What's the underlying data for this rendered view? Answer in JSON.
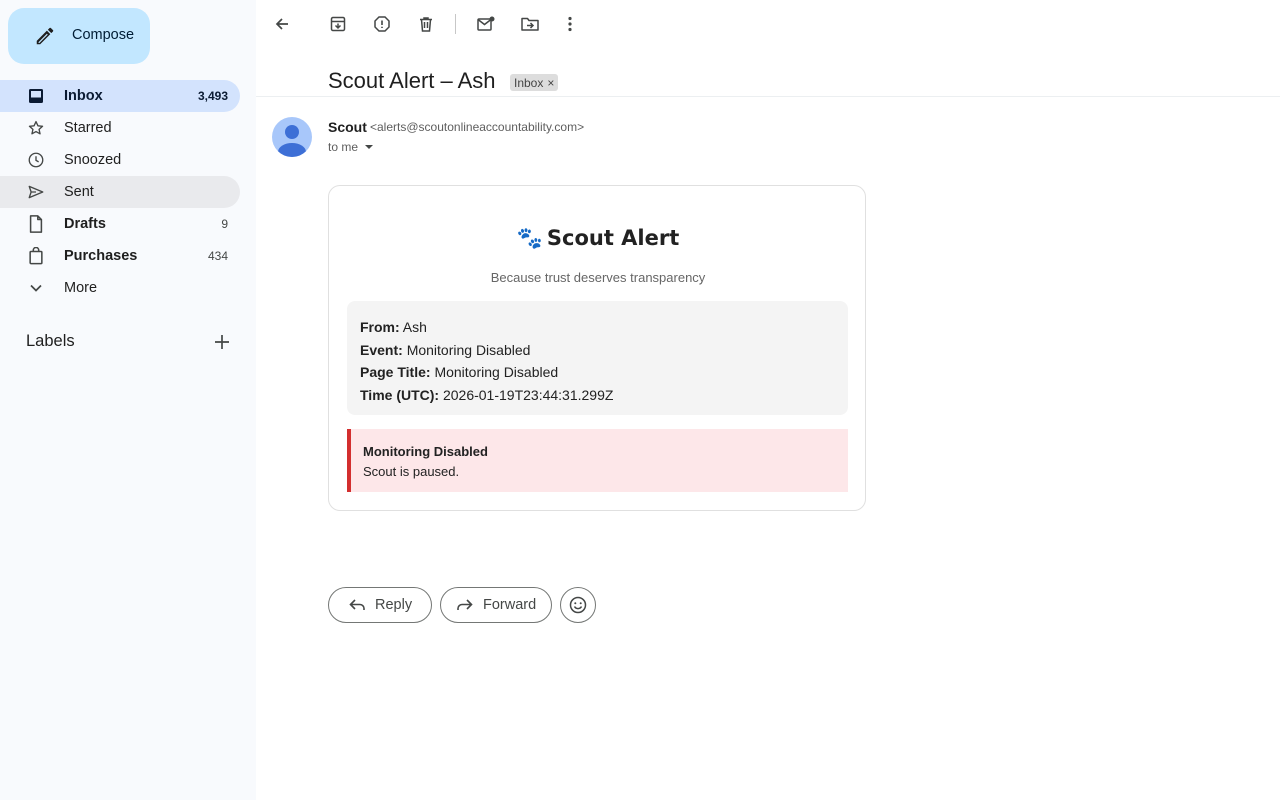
{
  "sidebar": {
    "compose_label": "Compose",
    "items": [
      {
        "label": "Inbox",
        "count": "3,493"
      },
      {
        "label": "Starred",
        "count": ""
      },
      {
        "label": "Snoozed",
        "count": ""
      },
      {
        "label": "Sent",
        "count": ""
      },
      {
        "label": "Drafts",
        "count": "9"
      },
      {
        "label": "Purchases",
        "count": "434"
      },
      {
        "label": "More",
        "count": ""
      }
    ],
    "labels_header": "Labels"
  },
  "toolbar": {
    "icons": [
      "back-icon",
      "archive-icon",
      "report-spam-icon",
      "delete-icon",
      "mark-unread-icon",
      "move-to-icon",
      "more-options-icon"
    ]
  },
  "email": {
    "subject": "Scout Alert – Ash",
    "label_chip": "Inbox",
    "label_chip_remove": "×",
    "sender_name": "Scout",
    "sender_email": "<alerts@scoutonlineaccountability.com>",
    "to_text": "to me",
    "card": {
      "title_icon": "🐾",
      "title": "Scout Alert",
      "tagline": "Because trust deserves transparency",
      "details": [
        {
          "key": "From:",
          "value": "Ash"
        },
        {
          "key": "Event:",
          "value": "Monitoring Disabled"
        },
        {
          "key": "Page Title:",
          "value": "Monitoring Disabled"
        },
        {
          "key": "Time (UTC):",
          "value": "2026-01-19T23:44:31.299Z"
        }
      ],
      "warning_title": "Monitoring Disabled",
      "warning_text": "Scout is paused."
    }
  },
  "actions": {
    "reply_label": "Reply",
    "forward_label": "Forward"
  },
  "colors": {
    "compose_bg": "#c2e7ff",
    "active_nav_bg": "#d3e3fd",
    "warning_border": "#d32f2f",
    "warning_bg": "#fde7e9"
  }
}
